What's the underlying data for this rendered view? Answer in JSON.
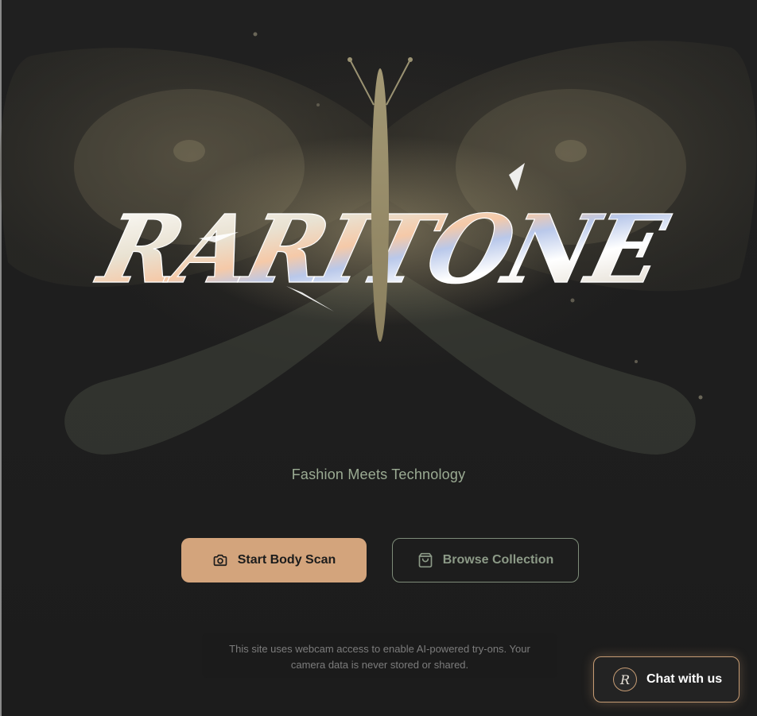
{
  "brand": {
    "logo_text": "RARITONE",
    "tagline": "Fashion Meets Technology"
  },
  "actions": {
    "scan_label": "Start Body Scan",
    "browse_label": "Browse Collection"
  },
  "notice": {
    "text": "This site uses webcam access to enable AI-powered try-ons. Your camera data is never stored or shared."
  },
  "chat": {
    "label": "Chat with us",
    "avatar_letter": "R"
  },
  "icons": {
    "scan": "camera-icon",
    "browse": "shopping-bag-icon"
  },
  "colors": {
    "accent": "#d3a47c",
    "tagline": "#9bab93",
    "background": "#1e1e1e"
  }
}
